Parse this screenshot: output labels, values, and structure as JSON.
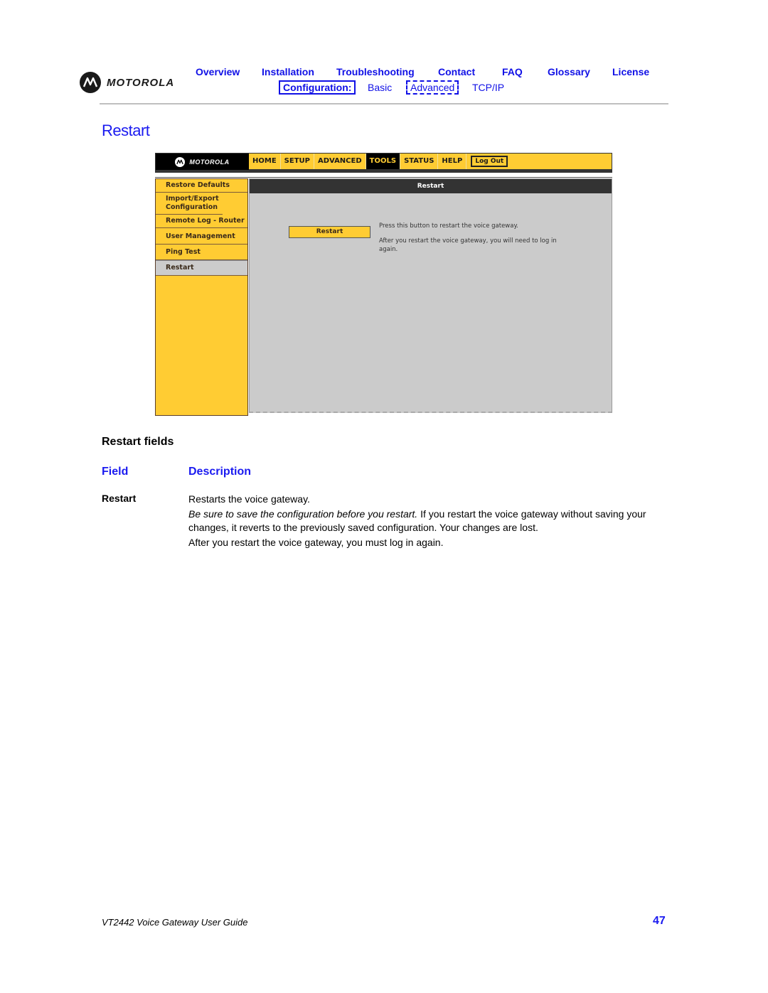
{
  "header": {
    "brand": "MOTOROLA",
    "nav": [
      {
        "label": "Overview"
      },
      {
        "label": "Installation"
      },
      {
        "label": "Troubleshooting"
      },
      {
        "label": "Contact"
      },
      {
        "label": "FAQ"
      },
      {
        "label": "Glossary"
      },
      {
        "label": "License"
      }
    ],
    "subnav": {
      "config_label": "Configuration:",
      "items": [
        {
          "label": "Basic"
        },
        {
          "label": "Advanced"
        },
        {
          "label": "TCP/IP"
        }
      ]
    }
  },
  "page_title": "Restart",
  "router_ui": {
    "brand": "MOTOROLA",
    "tabs": [
      {
        "label": "HOME"
      },
      {
        "label": "SETUP"
      },
      {
        "label": "ADVANCED"
      },
      {
        "label": "TOOLS",
        "active": true
      },
      {
        "label": "STATUS"
      },
      {
        "label": "HELP"
      }
    ],
    "logout_label": "Log Out",
    "sidebar": [
      {
        "label": "Restore Defaults"
      },
      {
        "label": "Import/Export Configuration"
      },
      {
        "label": "Remote Log - Router"
      },
      {
        "label": "User Management"
      },
      {
        "label": "Ping Test"
      },
      {
        "label": "Restart",
        "active": true
      }
    ],
    "panel_title": "Restart",
    "button_label": "Restart",
    "text1": "Press this button to restart the voice gateway.",
    "text2": "After you restart the voice gateway, you will need to log in again."
  },
  "fields_section": {
    "title": "Restart fields",
    "headers": {
      "field": "Field",
      "description": "Description"
    },
    "rows": [
      {
        "field": "Restart",
        "desc1": "Restarts the voice gateway.",
        "desc2_italic": "Be sure to save the configuration before you restart.",
        "desc2_rest": " If you restart the voice gateway without saving your changes, it reverts to the previously saved configuration. Your changes are lost.",
        "desc3": "After you restart the voice gateway, you must log in again."
      }
    ]
  },
  "footer": {
    "guide_title": "VT2442 Voice Gateway User Guide",
    "page_number": "47"
  },
  "colors": {
    "link_blue": "#1010e6",
    "router_yellow": "#ffcc33",
    "router_dark": "#333333",
    "panel_gray": "#cbcbcb"
  }
}
